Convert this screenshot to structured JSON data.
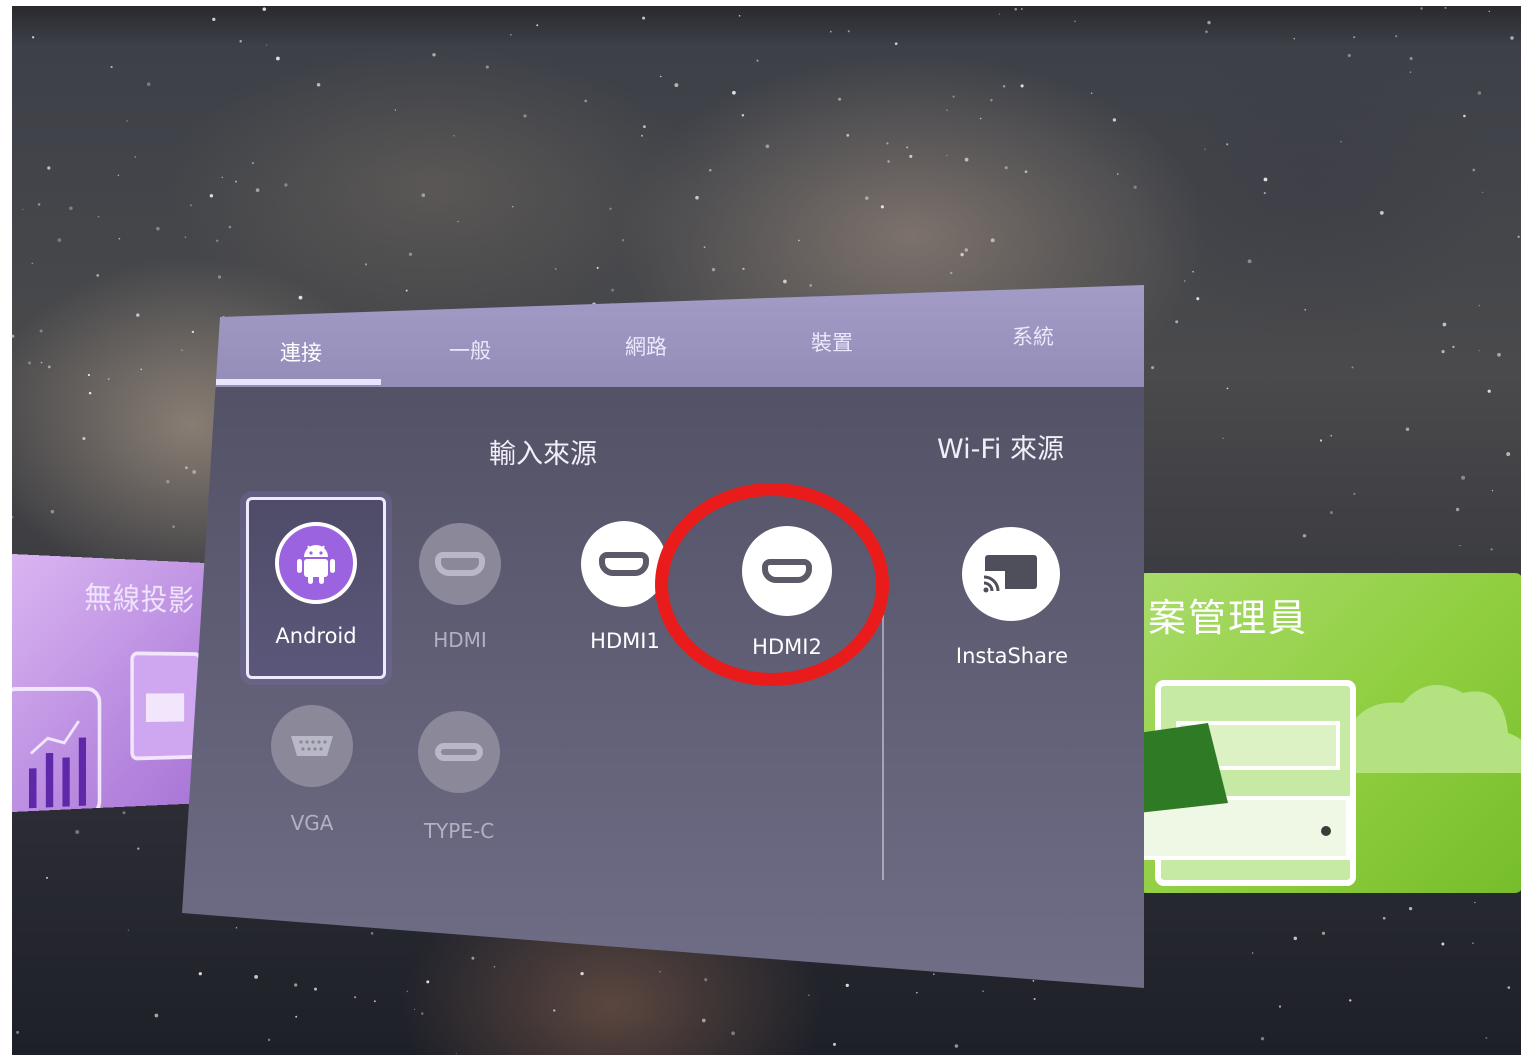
{
  "tabs": [
    {
      "label": "連接",
      "active": true
    },
    {
      "label": "一般",
      "active": false
    },
    {
      "label": "網路",
      "active": false
    },
    {
      "label": "裝置",
      "active": false
    },
    {
      "label": "系統",
      "active": false
    }
  ],
  "sections": {
    "input_source": "輸入來源",
    "wifi_source": "Wi-Fi 來源"
  },
  "sources": {
    "android": {
      "label": "Android",
      "icon": "android-icon",
      "selected": true
    },
    "hdmi": {
      "label": "HDMI",
      "icon": "hdmi-icon",
      "enabled": false
    },
    "hdmi1": {
      "label": "HDMI1",
      "icon": "hdmi-icon",
      "enabled": true
    },
    "hdmi2": {
      "label": "HDMI2",
      "icon": "hdmi-icon",
      "enabled": true,
      "highlighted": true
    },
    "vga": {
      "label": "VGA",
      "icon": "vga-icon",
      "enabled": false
    },
    "typec": {
      "label": "TYPE-C",
      "icon": "usb-c-icon",
      "enabled": false
    },
    "instashare": {
      "label": "InstaShare",
      "icon": "cast-icon",
      "enabled": true
    }
  },
  "side_cards": {
    "left_title": "無線投影",
    "right_title": "案管理員"
  },
  "colors": {
    "highlight_ring": "#ea1b1b",
    "tab_bar": "#9f99c4",
    "android_purple": "#9b63e0",
    "right_card_green": "#8fce3f",
    "left_card_purple": "#b98be0"
  }
}
